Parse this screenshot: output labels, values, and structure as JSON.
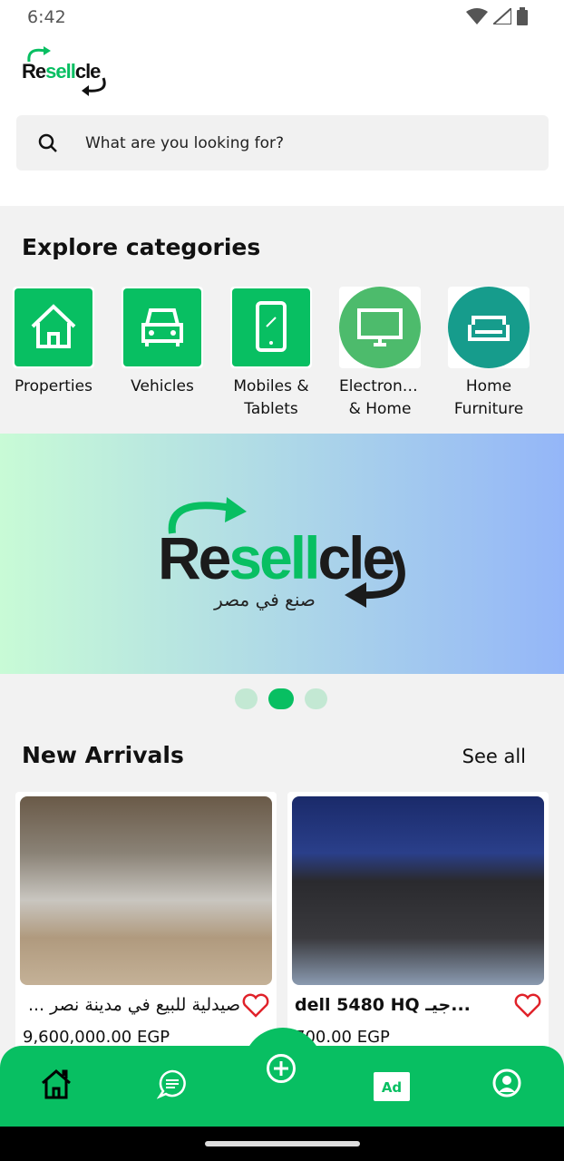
{
  "status_bar": {
    "time": "6:42"
  },
  "app": {
    "logo_text": "Resellcle",
    "brand_color": "#08bf62"
  },
  "search": {
    "placeholder": "What are you looking for?"
  },
  "categories": {
    "title": "Explore categories",
    "items": [
      {
        "label": "Properties",
        "icon": "house-icon"
      },
      {
        "label": "Vehicles",
        "icon": "car-icon"
      },
      {
        "label": "Mobiles & Tablets",
        "icon": "phone-icon"
      },
      {
        "label": "Electronics & Home ...",
        "icon": "monitor-icon"
      },
      {
        "label": "Home Furniture -...",
        "icon": "sofa-icon"
      }
    ]
  },
  "banner": {
    "logo_text": "Resellcle",
    "tagline": "صنع في مصر",
    "active_slide": 2,
    "slides": 3
  },
  "new_arrivals": {
    "title": "New Arrivals",
    "see_all": "See all",
    "items": [
      {
        "title": "صيدلية للبيع في مدينة نصر ...",
        "price": "9,600,000.00 EGP"
      },
      {
        "title": "dell 5480 HQ  جيـ...",
        "price": "​700.00 EGP"
      }
    ]
  },
  "nav": {
    "items": [
      "home-icon",
      "chat-icon",
      "add-icon",
      "ad-icon",
      "profile-icon"
    ]
  }
}
